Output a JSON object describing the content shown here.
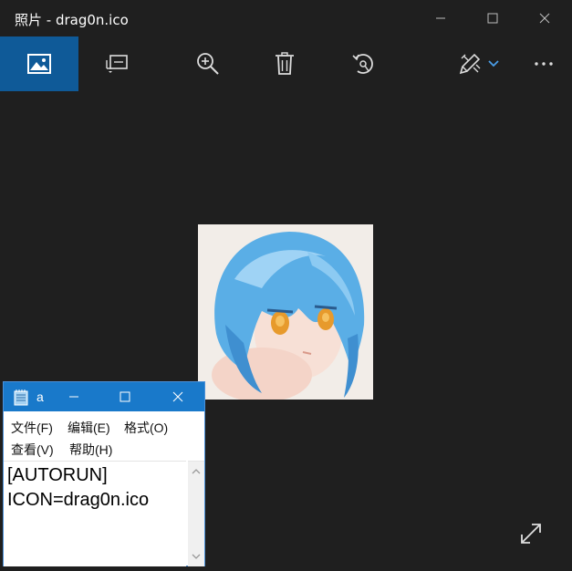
{
  "window": {
    "title": "照片 - drag0n.ico"
  },
  "toolbar": {
    "items": [
      {
        "name": "view-image",
        "icon": "image-icon",
        "active": true
      },
      {
        "name": "slideshow",
        "icon": "slideshow-icon"
      },
      {
        "name": "zoom",
        "icon": "zoom-in-icon"
      },
      {
        "name": "delete",
        "icon": "trash-icon"
      },
      {
        "name": "rotate",
        "icon": "rotate-icon"
      },
      {
        "name": "edit-create",
        "icon": "edit-icon"
      },
      {
        "name": "more",
        "icon": "more-icon"
      }
    ]
  },
  "accent": "#0f5a98",
  "notepad": {
    "title": "a",
    "menu": {
      "file": "文件(F)",
      "edit": "编辑(E)",
      "format": "格式(O)",
      "view": "查看(V)",
      "help": "帮助(H)"
    },
    "content": {
      "line1": "[AUTORUN]",
      "line2": "ICON=drag0n.ico"
    }
  }
}
